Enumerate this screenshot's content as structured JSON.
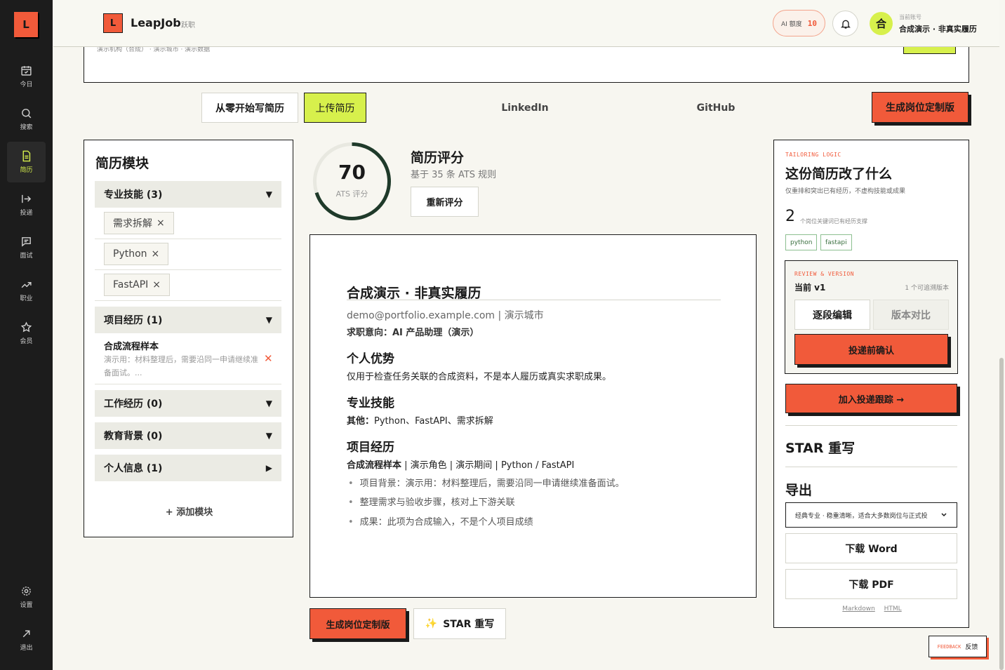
{
  "rail": {
    "logo": "L",
    "items": [
      {
        "label": "今日",
        "icon": "calendar-check-icon"
      },
      {
        "label": "搜索",
        "icon": "search-icon"
      },
      {
        "label": "简历",
        "icon": "document-icon"
      },
      {
        "label": "投递",
        "icon": "send-arrow-icon"
      },
      {
        "label": "面试",
        "icon": "chat-icon"
      },
      {
        "label": "职业",
        "icon": "trend-icon"
      },
      {
        "label": "会员",
        "icon": "star-icon"
      }
    ],
    "bottom": [
      {
        "label": "设置",
        "icon": "gear-icon"
      },
      {
        "label": "退出",
        "icon": "logout-icon"
      }
    ]
  },
  "header": {
    "logo": "L",
    "brand": "LeapJob",
    "brand_sub": "跃职",
    "quota_label": "AI 额度",
    "quota_value": "10",
    "account_label": "当前账号",
    "account_initial": "合",
    "account_name": "合成演示 · 非真实履历"
  },
  "topbox": {
    "text": "演示机构（合成） · 演示城市 · 演示数据"
  },
  "tabs": {
    "scratch": "从零开始写简历",
    "upload": "上传简历",
    "linkedin": "LinkedIn",
    "github": "GitHub",
    "generate": "生成岗位定制版"
  },
  "modules": {
    "title": "简历模块",
    "skills_head": "专业技能 (3)",
    "skills": [
      "需求拆解",
      "Python",
      "FastAPI"
    ],
    "projects_head": "项目经历 (1)",
    "project_name": "合成流程样本",
    "project_desc": "演示用：材料整理后，需要沿同一申请继续准备面试。...",
    "work_head": "工作经历 (0)",
    "edu_head": "教育背景 (0)",
    "info_head": "个人信息 (1)",
    "add": "+ 添加模块"
  },
  "score": {
    "value": 70,
    "value_text": "70",
    "label": "ATS 评分",
    "title": "简历评分",
    "subtitle": "基于 35 条 ATS 规则",
    "rescore": "重新评分",
    "max": 100
  },
  "resume": {
    "name": "合成演示 · 非真实履历",
    "contact": "demo@portfolio.example.com | 演示城市",
    "intent": "求职意向：AI 产品助理（演示）",
    "summary_h": "个人优势",
    "summary": "仅用于检查任务关联的合成资料，不是本人履历或真实求职成果。",
    "skills_h": "专业技能",
    "skills_prefix": "其他：",
    "skills": "Python、FastAPI、需求拆解",
    "proj_h": "项目经历",
    "proj_name": "合成流程样本",
    "proj_meta": " | 演示角色 | 演示期间 | Python / FastAPI",
    "bullets": [
      "项目背景：演示用：材料整理后，需要沿同一申请继续准备面试。",
      "整理需求与验收步骤，核对上下游关联",
      "成果：此项为合成输入，不是个人项目成绩"
    ]
  },
  "bottom_actions": {
    "generate": "生成岗位定制版",
    "star": "STAR 重写",
    "star_icon": "sparkle-icon"
  },
  "tailoring": {
    "kicker": "TAILORING LOGIC",
    "title": "这份简历改了什么",
    "subtitle": "仅重排和突出已有经历，不虚构技能或成果",
    "count": "2",
    "count_label": "个岗位关键词已有经历支撑",
    "keywords": [
      "python",
      "fastapi"
    ]
  },
  "review": {
    "kicker": "REVIEW & VERSION",
    "current": "当前 v1",
    "count": "1 个可追溯版本",
    "edit": "逐段编辑",
    "compare": "版本对比",
    "confirm": "投递前确认"
  },
  "track": "加入投递跟踪 →",
  "star_h": "STAR 重写",
  "export": {
    "title": "导出",
    "template": "经典专业 · 稳重清晰，适合大多数岗位与正式投",
    "word": "下载 Word",
    "pdf": "下载 PDF",
    "md": "Markdown",
    "html": "HTML"
  },
  "feedback": {
    "kicker": "FEEDBACK",
    "label": "反馈"
  },
  "colors": {
    "accent": "#f15a3a",
    "lime": "#d7f04c",
    "dark": "#1c1c1c",
    "ring": "#1f3a2a"
  }
}
